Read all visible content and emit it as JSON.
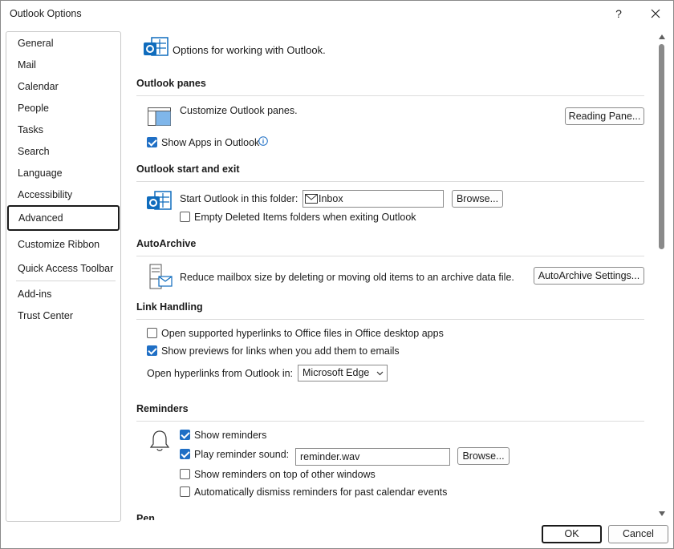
{
  "window": {
    "title": "Outlook Options",
    "help_label": "?",
    "close_label": "✕"
  },
  "nav": {
    "items": [
      {
        "label": "General"
      },
      {
        "label": "Mail"
      },
      {
        "label": "Calendar"
      },
      {
        "label": "People"
      },
      {
        "label": "Tasks"
      },
      {
        "label": "Search"
      },
      {
        "label": "Language"
      },
      {
        "label": "Accessibility"
      },
      {
        "label": "Advanced",
        "selected": true
      },
      {
        "label": "Customize Ribbon"
      },
      {
        "label": "Quick Access Toolbar"
      },
      {
        "label": "Add-ins"
      },
      {
        "label": "Trust Center"
      }
    ]
  },
  "header": {
    "text": "Options for working with Outlook."
  },
  "outlook_panes": {
    "title": "Outlook panes",
    "description": "Customize Outlook panes.",
    "reading_pane_button": "Reading Pane...",
    "show_apps_label": "Show Apps in Outlook",
    "show_apps_checked": true
  },
  "start_exit": {
    "title": "Outlook start and exit",
    "start_folder_label": "Start Outlook in this folder:",
    "start_folder_value": "Inbox",
    "browse_button": "Browse...",
    "empty_deleted_label": "Empty Deleted Items folders when exiting Outlook",
    "empty_deleted_checked": false
  },
  "autoarchive": {
    "title": "AutoArchive",
    "description": "Reduce mailbox size by deleting or moving old items to an archive data file.",
    "settings_button": "AutoArchive Settings..."
  },
  "link_handling": {
    "title": "Link Handling",
    "open_supported_label": "Open supported hyperlinks to Office files in Office desktop apps",
    "open_supported_checked": false,
    "show_previews_label": "Show previews for links when you add them to emails",
    "show_previews_checked": true,
    "open_from_label": "Open hyperlinks from Outlook in:",
    "open_from_value": "Microsoft Edge"
  },
  "reminders": {
    "title": "Reminders",
    "show_reminders_label": "Show reminders",
    "show_reminders_checked": true,
    "play_sound_label": "Play reminder sound:",
    "play_sound_checked": true,
    "sound_file": "reminder.wav",
    "browse_button": "Browse...",
    "on_top_label": "Show reminders on top of other windows",
    "on_top_checked": false,
    "auto_dismiss_label": "Automatically dismiss reminders for past calendar events",
    "auto_dismiss_checked": false
  },
  "pen": {
    "title": "Pen"
  },
  "footer": {
    "ok_label": "OK",
    "cancel_label": "Cancel"
  },
  "colors": {
    "accent": "#1f6fc5",
    "icon_blue": "#0f6cbd"
  }
}
